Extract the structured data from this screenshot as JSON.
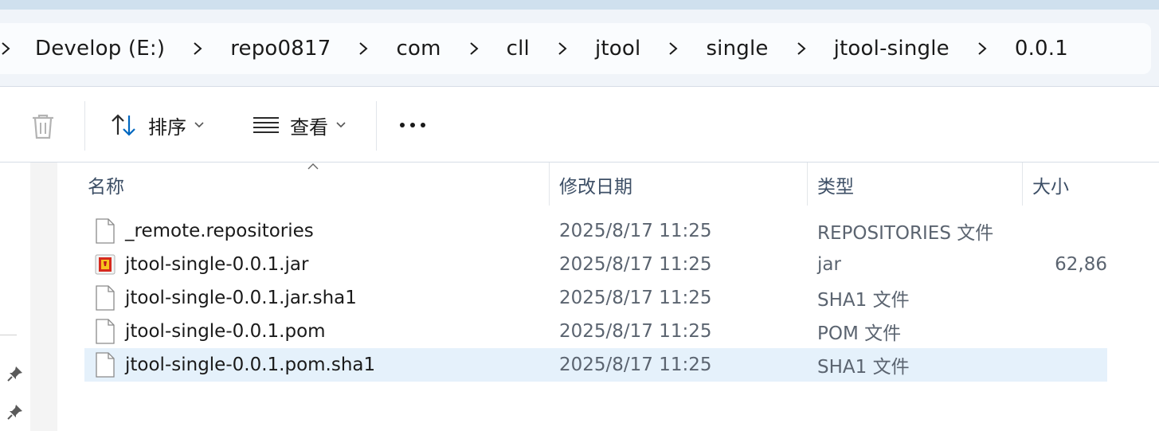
{
  "breadcrumb": [
    "Develop (E:)",
    "repo0817",
    "com",
    "cll",
    "jtool",
    "single",
    "jtool-single",
    "0.0.1"
  ],
  "toolbar": {
    "sort_label": "排序",
    "view_label": "查看"
  },
  "columns": {
    "name": "名称",
    "modified": "修改日期",
    "type": "类型",
    "size": "大小"
  },
  "files": [
    {
      "name": "_remote.repositories",
      "modified": "2025/8/17 11:25",
      "type": "REPOSITORIES 文件",
      "size": "",
      "icon": "file-icon"
    },
    {
      "name": "jtool-single-0.0.1.jar",
      "modified": "2025/8/17 11:25",
      "type": "jar",
      "size": "62,86",
      "icon": "jar-file-icon"
    },
    {
      "name": "jtool-single-0.0.1.jar.sha1",
      "modified": "2025/8/17 11:25",
      "type": "SHA1 文件",
      "size": "",
      "icon": "file-icon"
    },
    {
      "name": "jtool-single-0.0.1.pom",
      "modified": "2025/8/17 11:25",
      "type": "POM 文件",
      "size": "",
      "icon": "file-icon"
    },
    {
      "name": "jtool-single-0.0.1.pom.sha1",
      "modified": "2025/8/17 11:25",
      "type": "SHA1 文件",
      "size": "",
      "icon": "file-icon",
      "selected": true
    }
  ],
  "colors": {
    "selection": "#e5f1fb",
    "address_bg": "#f0f4f9",
    "accent": "#0067c0"
  }
}
